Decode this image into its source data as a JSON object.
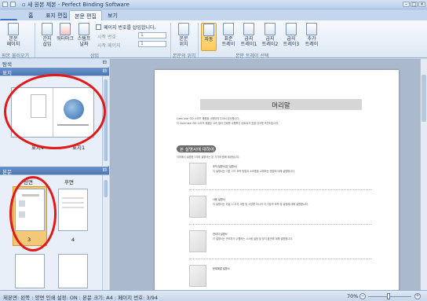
{
  "window": {
    "title": "▫ 새 원본 제본 - Perfect Binding Software"
  },
  "tabs": [
    {
      "label": "홈"
    },
    {
      "label": "표지 편집"
    },
    {
      "label": "본문 편집",
      "active": true
    },
    {
      "label": "보기"
    }
  ],
  "ribbon": {
    "buttons": [
      {
        "label": "본문\n페이지"
      },
      {
        "label": "간지\n삽입"
      },
      {
        "label": "워터마크"
      },
      {
        "label": "스탬프\n날짜"
      },
      {
        "label": "본문\n위치"
      },
      {
        "label": "자동"
      },
      {
        "label": "표준\n트레이"
      },
      {
        "label": "급지\n트레이1"
      },
      {
        "label": "급지\n트레이2"
      },
      {
        "label": "급지\n트레이3"
      },
      {
        "label": "추가\n트레이"
      }
    ],
    "page_number_check": "페이지 번호를 삽입합니다.",
    "start_number_label": "시작 번호",
    "start_page_label": "시작 페이지",
    "start_number_value": "1",
    "start_page_value": "1",
    "groups": [
      {
        "label": "원본 불러오기"
      },
      {
        "label": "삽입"
      },
      {
        "label": "본문의 위치"
      },
      {
        "label": "본문 트레이 선택"
      }
    ]
  },
  "left_pane": {
    "nav_header": "탐색",
    "cover_header": "표지",
    "cover_labels": [
      "표지4",
      "표지1"
    ],
    "body_header": "본문",
    "body_columns": [
      "전면",
      "후면"
    ],
    "body_pages": [
      "3",
      "4"
    ]
  },
  "document": {
    "heading": "머리말",
    "intro_line1": "ComColor GD 시리즈 제품을 사용하여 주셔서 감사합니다.",
    "intro_line2": "이 ComColor GD 시리즈 제품은 고속 컬러 인쇄를 수행하는 네트워크 호환 잉크젯 프린터입니다.",
    "section_title": "본 설명서에 대하여",
    "section_desc": "이하에서 설명한 5개의 설명서는 본 기기와 함께 제공됩니다.",
    "items": [
      {
        "title": "조작 설명서(본 설명서)",
        "text": "이 설명서는 기본 기기 조작 방법과 소모품을 교체하는 방법에 대해 설명합니다."
      },
      {
        "title": "사용 설명서",
        "text": "이 설명서는 취급 시 주의 사항 및 사양뿐 아니라 각 기능의 조작 및 설정에 대해 설명합니다."
      },
      {
        "title": "관리자 설명서",
        "text": "이 설명서는 관리자가 수행하는 시스템 설정 및 장치 옵션에 대해 설명합니다."
      },
      {
        "title": "문제해결 설명서",
        "text": ""
      }
    ]
  },
  "status_bar": {
    "text": "제본면: 왼쪽  :  양면 인쇄 설정: ON  :  본문 크기: A4  :  페이지 번호: 3/94",
    "zoom": "70%"
  },
  "colors": {
    "ribbon_accent": "#2a59a5",
    "annotation_red": "#e11919",
    "selected_button": "#ffc95a"
  }
}
